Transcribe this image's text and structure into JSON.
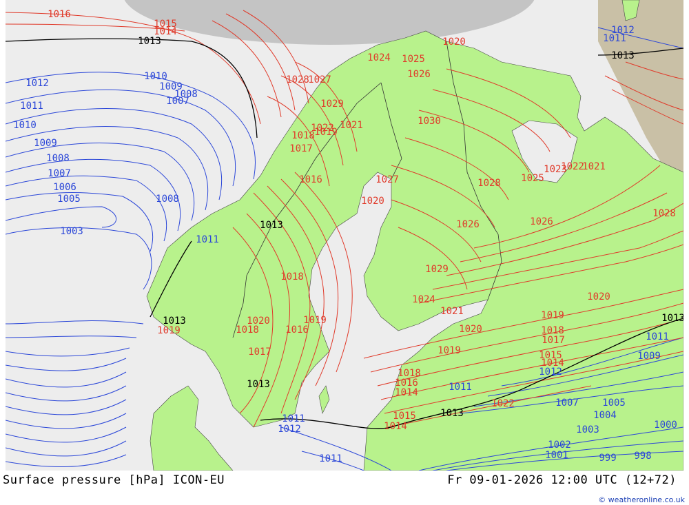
{
  "footer": {
    "title": "Surface pressure [hPa] ICON-EU",
    "valid_time": "Fr 09-01-2026 12:00 UTC (12+72)",
    "credit": "© weatheronline.co.uk"
  },
  "colors": {
    "land": "#b8f28c",
    "sea": "#ededed",
    "unknown_area": "#c4c4c4",
    "russia_tint": "#c9c0a6",
    "isobar_high": "#e03a2a",
    "isobar_low": "#2a46d8",
    "isobar_1013": "#000000"
  },
  "map": {
    "isobar_labels": [
      {
        "text": "1016",
        "color": "red"
      },
      {
        "text": "1015",
        "color": "red"
      },
      {
        "text": "1014",
        "color": "red"
      },
      {
        "text": "1013",
        "color": "black"
      },
      {
        "text": "1012",
        "color": "blue"
      },
      {
        "text": "1011",
        "color": "blue"
      },
      {
        "text": "1010",
        "color": "blue"
      },
      {
        "text": "1009",
        "color": "blue"
      },
      {
        "text": "1008",
        "color": "blue"
      },
      {
        "text": "1007",
        "color": "blue"
      },
      {
        "text": "1006",
        "color": "blue"
      },
      {
        "text": "1005",
        "color": "blue"
      },
      {
        "text": "1003",
        "color": "blue"
      },
      {
        "text": "1010",
        "color": "blue"
      },
      {
        "text": "1009",
        "color": "blue"
      },
      {
        "text": "1008",
        "color": "blue"
      },
      {
        "text": "1007",
        "color": "blue"
      },
      {
        "text": "1008",
        "color": "blue"
      },
      {
        "text": "1020",
        "color": "red"
      },
      {
        "text": "1025",
        "color": "red"
      },
      {
        "text": "1024",
        "color": "red"
      },
      {
        "text": "1026",
        "color": "red"
      },
      {
        "text": "1027",
        "color": "red"
      },
      {
        "text": "1028",
        "color": "red"
      },
      {
        "text": "1029",
        "color": "red"
      },
      {
        "text": "1030",
        "color": "red"
      },
      {
        "text": "1022",
        "color": "red"
      },
      {
        "text": "1021",
        "color": "red"
      },
      {
        "text": "1019",
        "color": "red"
      },
      {
        "text": "1018",
        "color": "red"
      },
      {
        "text": "1017",
        "color": "red"
      },
      {
        "text": "1016",
        "color": "red"
      },
      {
        "text": "1013",
        "color": "black"
      },
      {
        "text": "1011",
        "color": "blue"
      },
      {
        "text": "1012",
        "color": "blue"
      },
      {
        "text": "1013",
        "color": "black"
      },
      {
        "text": "1015",
        "color": "red"
      },
      {
        "text": "1014",
        "color": "red"
      },
      {
        "text": "1013",
        "color": "black"
      },
      {
        "text": "1012",
        "color": "blue"
      },
      {
        "text": "1011",
        "color": "blue"
      },
      {
        "text": "1007",
        "color": "blue"
      },
      {
        "text": "1005",
        "color": "blue"
      },
      {
        "text": "1004",
        "color": "blue"
      },
      {
        "text": "1003",
        "color": "blue"
      },
      {
        "text": "1002",
        "color": "blue"
      },
      {
        "text": "1001",
        "color": "blue"
      },
      {
        "text": "999",
        "color": "blue"
      },
      {
        "text": "998",
        "color": "blue"
      },
      {
        "text": "1000",
        "color": "blue"
      },
      {
        "text": "1009",
        "color": "blue"
      },
      {
        "text": "1011",
        "color": "blue"
      },
      {
        "text": "1013",
        "color": "black"
      },
      {
        "text": "1019",
        "color": "red"
      },
      {
        "text": "1018",
        "color": "red"
      },
      {
        "text": "1017",
        "color": "red"
      },
      {
        "text": "1015",
        "color": "red"
      },
      {
        "text": "1014",
        "color": "red"
      },
      {
        "text": "1012",
        "color": "blue"
      },
      {
        "text": "1023",
        "color": "red"
      },
      {
        "text": "1022",
        "color": "red"
      },
      {
        "text": "1021",
        "color": "red"
      },
      {
        "text": "1020",
        "color": "red"
      },
      {
        "text": "1026",
        "color": "red"
      },
      {
        "text": "1025",
        "color": "red"
      },
      {
        "text": "1028",
        "color": "red"
      },
      {
        "text": "1026",
        "color": "red"
      },
      {
        "text": "1024",
        "color": "red"
      },
      {
        "text": "1021",
        "color": "red"
      },
      {
        "text": "1020",
        "color": "red"
      },
      {
        "text": "1019",
        "color": "red"
      },
      {
        "text": "1018",
        "color": "red"
      },
      {
        "text": "1016",
        "color": "red"
      },
      {
        "text": "1014",
        "color": "red"
      },
      {
        "text": "1011",
        "color": "blue"
      },
      {
        "text": "1013",
        "color": "black"
      },
      {
        "text": "1011",
        "color": "blue"
      },
      {
        "text": "1022",
        "color": "red"
      },
      {
        "text": "1028",
        "color": "red"
      },
      {
        "text": "1029",
        "color": "red"
      },
      {
        "text": "1027",
        "color": "red"
      },
      {
        "text": "1020",
        "color": "red"
      },
      {
        "text": "1019",
        "color": "red"
      },
      {
        "text": "1016",
        "color": "red"
      },
      {
        "text": "1017",
        "color": "red"
      },
      {
        "text": "1018",
        "color": "red"
      },
      {
        "text": "1013",
        "color": "black"
      },
      {
        "text": "1011",
        "color": "blue"
      },
      {
        "text": "1019",
        "color": "red"
      },
      {
        "text": "1020",
        "color": "red"
      },
      {
        "text": "1018",
        "color": "red"
      }
    ]
  }
}
